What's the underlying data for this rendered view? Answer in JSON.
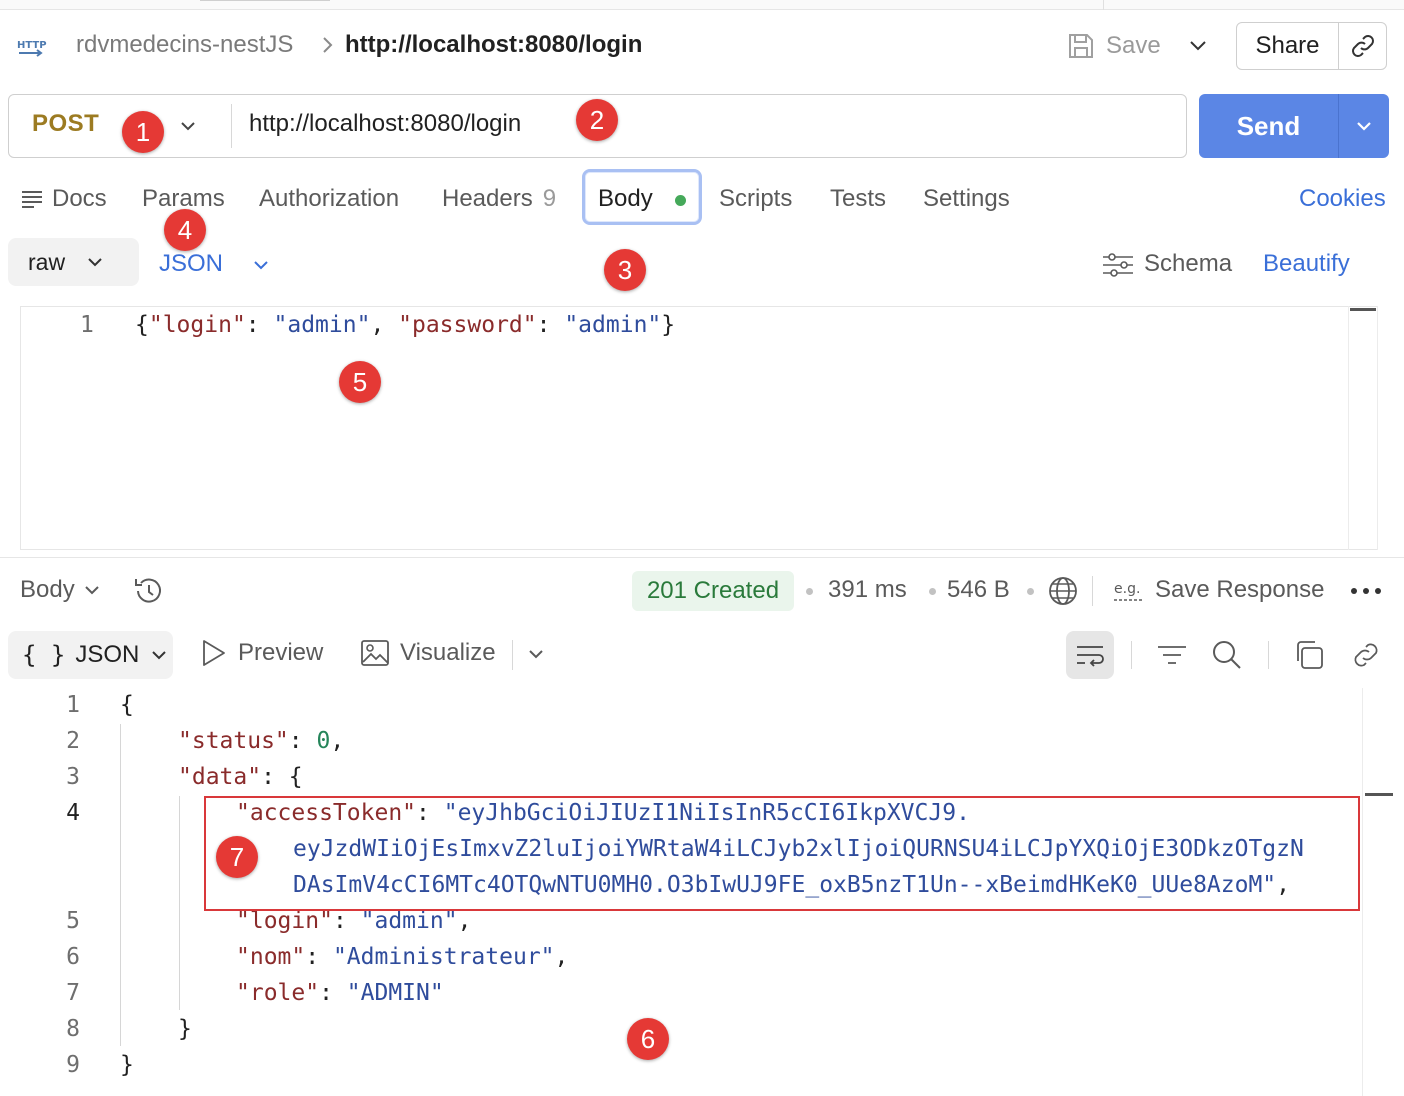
{
  "header": {
    "icon_text": "HTTP",
    "collection": "rdvmedecins-nestJS",
    "request_name": "http://localhost:8080/login",
    "save_label": "Save",
    "share_label": "Share"
  },
  "request": {
    "method": "POST",
    "url": "http://localhost:8080/login",
    "send_label": "Send"
  },
  "request_tabs": {
    "docs": "Docs",
    "params": "Params",
    "authorization": "Authorization",
    "headers": "Headers",
    "headers_count": "9",
    "body": "Body",
    "scripts": "Scripts",
    "tests": "Tests",
    "settings": "Settings",
    "cookies": "Cookies"
  },
  "body_options": {
    "mode": "raw",
    "language": "JSON",
    "schema_label": "Schema",
    "beautify_label": "Beautify"
  },
  "request_body": {
    "line_number": "1",
    "tokens": [
      "{",
      "\"login\"",
      ": ",
      "\"admin\"",
      ", ",
      "\"password\"",
      ": ",
      "\"admin\"",
      "}"
    ]
  },
  "response": {
    "body_label": "Body",
    "status": "201 Created",
    "time": "391 ms",
    "size": "546 B",
    "save_response_label": "Save Response",
    "format_label": "JSON",
    "preview_label": "Preview",
    "visualize_label": "Visualize",
    "lines": [
      {
        "no": "1",
        "t": [
          "{"
        ]
      },
      {
        "no": "2",
        "t": [
          "\"status\"",
          ": ",
          "0",
          ","
        ]
      },
      {
        "no": "3",
        "t": [
          "\"data\"",
          ": {"
        ]
      },
      {
        "no": "4",
        "t": [
          "\"accessToken\"",
          ": ",
          "\"eyJhbGciOiJIUzI1NiIsInR5cCI6IkpXVCJ9."
        ]
      },
      {
        "no": "",
        "t": [
          "eyJzdWIiOjEsImxvZ2luIjoiYWRtaW4iLCJyb2xlIjoiQURNSU4iLCJpYXQiOjE3ODkzOTgzN"
        ]
      },
      {
        "no": "",
        "t": [
          "DAsImV4cCI6MTc4OTQwNTU0MH0.O3bIwUJ9FE_oxB5nzT1Un--xBeimdHKeK0_UUe8AzoM\"",
          ","
        ]
      },
      {
        "no": "5",
        "t": [
          "\"login\"",
          ": ",
          "\"admin\"",
          ","
        ]
      },
      {
        "no": "6",
        "t": [
          "\"nom\"",
          ": ",
          "\"Administrateur\"",
          ","
        ]
      },
      {
        "no": "7",
        "t": [
          "\"role\"",
          ": ",
          "\"ADMIN\""
        ]
      },
      {
        "no": "8",
        "t": [
          "}"
        ]
      },
      {
        "no": "9",
        "t": [
          "}"
        ]
      }
    ]
  },
  "markers": [
    "1",
    "2",
    "3",
    "4",
    "5",
    "6",
    "7"
  ],
  "colors": {
    "send": "#5b86e5",
    "method": "#9c7b22",
    "link": "#3a6fd8",
    "status_ok": "#2a7a3b",
    "marker": "#e53935",
    "json_key": "#8a2b2b",
    "json_string": "#2f4c9c",
    "json_number": "#25855a"
  },
  "icons": {
    "http": "http-icon",
    "save": "save-icon",
    "share_link": "link-icon",
    "docs": "docs-icon",
    "history": "history-icon",
    "globe": "globe-icon",
    "wrap": "wrap-lines-icon",
    "filter": "filter-icon",
    "search": "search-icon",
    "copy": "copy-icon",
    "link": "link-icon"
  }
}
